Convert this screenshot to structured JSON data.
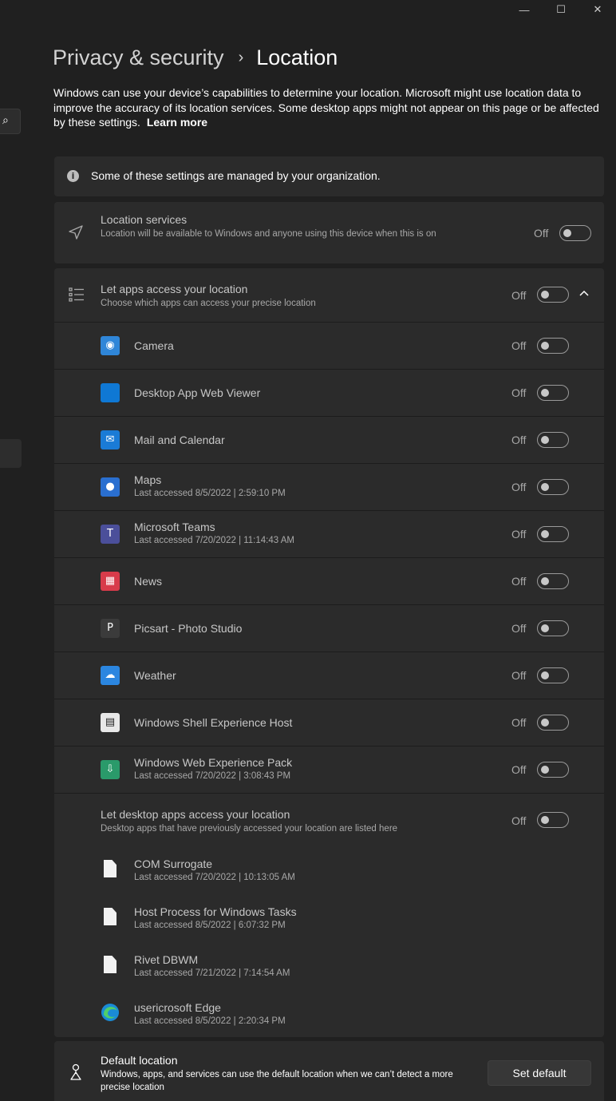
{
  "window": {
    "minimize_glyph": "—",
    "maximize_glyph": "☐",
    "close_glyph": "✕"
  },
  "sidebar": {
    "search_icon_glyph": "⌕"
  },
  "breadcrumb": {
    "parent": "Privacy & security",
    "separator": "›",
    "current": "Location"
  },
  "description": {
    "text": "Windows can use your device’s capabilities to determine your location. Microsoft might use location data to improve the accuracy of its location services. Some desktop apps might not appear on this page or be affected by these settings.",
    "link": "Learn more"
  },
  "info_banner": {
    "icon": "info-icon",
    "text": "Some of these settings are managed by your organization."
  },
  "location_services": {
    "title": "Location services",
    "subtitle": "Location will be available to Windows and anyone using this device when this is on",
    "state": "Off"
  },
  "apps_access": {
    "title": "Let apps access your location",
    "subtitle": "Choose which apps can access your precise location",
    "state": "Off",
    "apps": [
      {
        "name": "Camera",
        "last": "",
        "state": "Off",
        "icon": "camera-icon",
        "color": "#2f86d8"
      },
      {
        "name": "Desktop App Web Viewer",
        "last": "",
        "state": "Off",
        "icon": "web-viewer-icon",
        "color": "#0f78d4"
      },
      {
        "name": "Mail and Calendar",
        "last": "",
        "state": "Off",
        "icon": "mail-icon",
        "color": "#1a7bd6"
      },
      {
        "name": "Maps",
        "last": "Last accessed 8/5/2022  |  2:59:10 PM",
        "state": "Off",
        "icon": "maps-icon",
        "color": "#2a6fd0"
      },
      {
        "name": "Microsoft Teams",
        "last": "Last accessed 7/20/2022  |  11:14:43 AM",
        "state": "Off",
        "icon": "teams-icon",
        "color": "#4b4f9a"
      },
      {
        "name": "News",
        "last": "",
        "state": "Off",
        "icon": "news-icon",
        "color": "#d83b4a"
      },
      {
        "name": "Picsart - Photo Studio",
        "last": "",
        "state": "Off",
        "icon": "picsart-icon",
        "color": "#3b3b3b"
      },
      {
        "name": "Weather",
        "last": "",
        "state": "Off",
        "icon": "weather-icon",
        "color": "#2b86e0"
      },
      {
        "name": "Windows Shell Experience Host",
        "last": "",
        "state": "Off",
        "icon": "shell-host-icon",
        "color": "#e8e8e8"
      },
      {
        "name": "Windows Web Experience Pack",
        "last": "Last accessed 7/20/2022  |  3:08:43 PM",
        "state": "Off",
        "icon": "web-experience-icon",
        "color": "#2a9a6a"
      }
    ]
  },
  "desktop_apps": {
    "title": "Let desktop apps access your location",
    "subtitle": "Desktop apps that have previously accessed your location are listed here",
    "state": "Off",
    "apps": [
      {
        "name": "COM Surrogate",
        "last": "Last accessed 7/20/2022  |  10:13:05 AM",
        "icon": "file-icon"
      },
      {
        "name": "Host Process for Windows Tasks",
        "last": "Last accessed 8/5/2022  |  6:07:32 PM",
        "icon": "file-icon"
      },
      {
        "name": "Rivet DBWM",
        "last": "Last accessed 7/21/2022  |  7:14:54 AM",
        "icon": "file-icon"
      },
      {
        "name": "usericrosoft Edge",
        "last": "Last accessed 8/5/2022  |  2:20:34 PM",
        "icon": "edge-icon"
      }
    ]
  },
  "default_location": {
    "title": "Default location",
    "subtitle": "Windows, apps, and services can use the default location when we can’t detect a more precise location",
    "button": "Set default"
  }
}
